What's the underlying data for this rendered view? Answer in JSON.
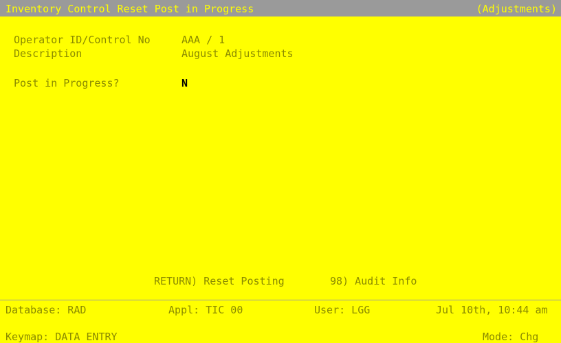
{
  "header": {
    "title": "Inventory Control Reset Post in Progress",
    "context": "(Adjustments)"
  },
  "form": {
    "operator_label": "Operator ID/Control No",
    "operator_value": "AAA / 1",
    "description_label": "Description",
    "description_value": "August Adjustments",
    "post_label": "Post in Progress?",
    "post_value": "N"
  },
  "actions": {
    "reset_posting": "RETURN) Reset Posting",
    "audit_info": "98) Audit Info"
  },
  "status": {
    "database": "Database: RAD",
    "appl": "Appl: TIC 00",
    "user": "User: LGG",
    "datetime": "Jul 10th, 10:44 am",
    "keymap": "Keymap: DATA ENTRY",
    "mode": "Mode: Chg"
  }
}
